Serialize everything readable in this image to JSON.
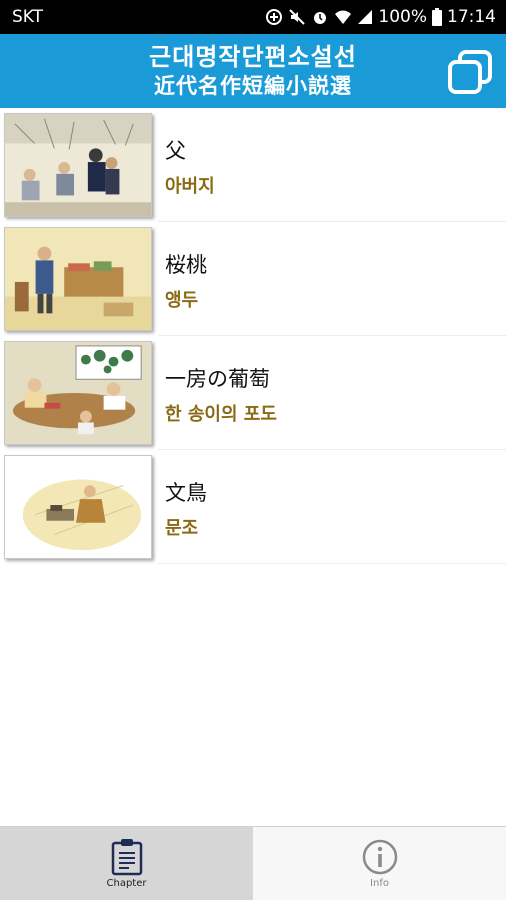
{
  "status_bar": {
    "carrier": "SKT",
    "battery": "100%",
    "time": "17:14"
  },
  "app_bar": {
    "title_ko": "근대명작단편소설선",
    "title_hanja": "近代名作短編小説選"
  },
  "stories": [
    {
      "title": "父",
      "subtitle": "아버지"
    },
    {
      "title": "桜桃",
      "subtitle": "앵두"
    },
    {
      "title": "一房の葡萄",
      "subtitle": "한 송이의 포도"
    },
    {
      "title": "文鳥",
      "subtitle": "문조"
    }
  ],
  "bottom_nav": {
    "tabs": [
      {
        "label": "Chapter",
        "icon": "clipboard-icon"
      },
      {
        "label": "Info",
        "icon": "info-icon"
      }
    ]
  },
  "colors": {
    "app_bar": "#1a9bd7",
    "subtitle": "#8a6a14",
    "active_tab": "#d6d6d6"
  }
}
